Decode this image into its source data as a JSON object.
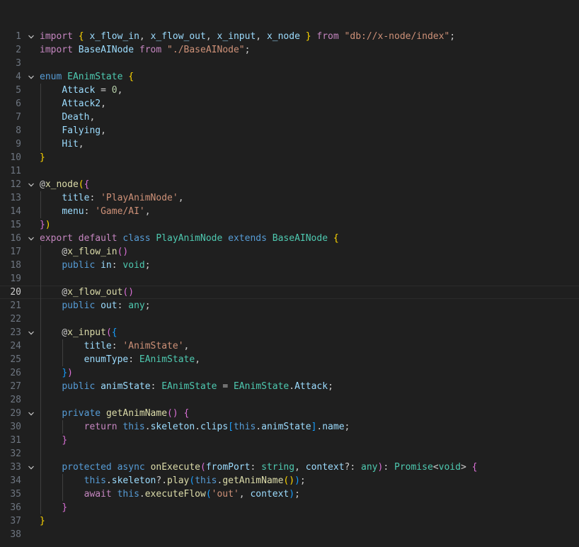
{
  "editor": {
    "foldable_lines": [
      1,
      4,
      12,
      16,
      23,
      29,
      33
    ],
    "active_line": 20,
    "colors": {
      "background": "#1f1f1f",
      "line_number": "#6e7681",
      "keyword": "#569cd6",
      "control": "#c586c0",
      "string": "#ce9178",
      "variable": "#9cdcfe",
      "type": "#4ec9b0",
      "function": "#dcdcaa",
      "number": "#b5cea8",
      "bracket_1": "#ffd700",
      "bracket_2": "#da70d6",
      "bracket_3": "#179fff"
    },
    "lines": [
      [
        [
          "ctl",
          "import"
        ],
        [
          "pun",
          " "
        ],
        [
          "b1",
          "{"
        ],
        [
          "pun",
          " "
        ],
        [
          "var",
          "x_flow_in"
        ],
        [
          "pun",
          ", "
        ],
        [
          "var",
          "x_flow_out"
        ],
        [
          "pun",
          ", "
        ],
        [
          "var",
          "x_input"
        ],
        [
          "pun",
          ", "
        ],
        [
          "var",
          "x_node"
        ],
        [
          "pun",
          " "
        ],
        [
          "b1",
          "}"
        ],
        [
          "pun",
          " "
        ],
        [
          "ctl",
          "from"
        ],
        [
          "pun",
          " "
        ],
        [
          "str",
          "\"db://x-node/index\""
        ],
        [
          "pun",
          ";"
        ]
      ],
      [
        [
          "ctl",
          "import"
        ],
        [
          "pun",
          " "
        ],
        [
          "var",
          "BaseAINode"
        ],
        [
          "pun",
          " "
        ],
        [
          "ctl",
          "from"
        ],
        [
          "pun",
          " "
        ],
        [
          "str",
          "\"./BaseAINode\""
        ],
        [
          "pun",
          ";"
        ]
      ],
      [],
      [
        [
          "kw",
          "enum"
        ],
        [
          "pun",
          " "
        ],
        [
          "typ",
          "EAnimState"
        ],
        [
          "pun",
          " "
        ],
        [
          "b1",
          "{"
        ]
      ],
      [
        [
          "pun",
          "    "
        ],
        [
          "var",
          "Attack"
        ],
        [
          "pun",
          " = "
        ],
        [
          "num",
          "0"
        ],
        [
          "pun",
          ","
        ]
      ],
      [
        [
          "pun",
          "    "
        ],
        [
          "var",
          "Attack2"
        ],
        [
          "pun",
          ","
        ]
      ],
      [
        [
          "pun",
          "    "
        ],
        [
          "var",
          "Death"
        ],
        [
          "pun",
          ","
        ]
      ],
      [
        [
          "pun",
          "    "
        ],
        [
          "var",
          "Falying"
        ],
        [
          "pun",
          ","
        ]
      ],
      [
        [
          "pun",
          "    "
        ],
        [
          "var",
          "Hit"
        ],
        [
          "pun",
          ","
        ]
      ],
      [
        [
          "b1",
          "}"
        ]
      ],
      [],
      [
        [
          "pun",
          "@"
        ],
        [
          "fn",
          "x_node"
        ],
        [
          "b1",
          "("
        ],
        [
          "b2",
          "{"
        ]
      ],
      [
        [
          "pun",
          "    "
        ],
        [
          "var",
          "title"
        ],
        [
          "pun",
          ": "
        ],
        [
          "str",
          "'PlayAnimNode'"
        ],
        [
          "pun",
          ","
        ]
      ],
      [
        [
          "pun",
          "    "
        ],
        [
          "var",
          "menu"
        ],
        [
          "pun",
          ": "
        ],
        [
          "str",
          "'Game/AI'"
        ],
        [
          "pun",
          ","
        ]
      ],
      [
        [
          "b2",
          "}"
        ],
        [
          "b1",
          ")"
        ]
      ],
      [
        [
          "ctl",
          "export"
        ],
        [
          "pun",
          " "
        ],
        [
          "ctl",
          "default"
        ],
        [
          "pun",
          " "
        ],
        [
          "kw",
          "class"
        ],
        [
          "pun",
          " "
        ],
        [
          "typ",
          "PlayAnimNode"
        ],
        [
          "pun",
          " "
        ],
        [
          "kw",
          "extends"
        ],
        [
          "pun",
          " "
        ],
        [
          "typ",
          "BaseAINode"
        ],
        [
          "pun",
          " "
        ],
        [
          "b1",
          "{"
        ]
      ],
      [
        [
          "pun",
          "    @"
        ],
        [
          "fn",
          "x_flow_in"
        ],
        [
          "b2",
          "()"
        ]
      ],
      [
        [
          "pun",
          "    "
        ],
        [
          "kw",
          "public"
        ],
        [
          "pun",
          " "
        ],
        [
          "var",
          "in"
        ],
        [
          "pun",
          ": "
        ],
        [
          "typ",
          "void"
        ],
        [
          "pun",
          ";"
        ]
      ],
      [],
      [
        [
          "pun",
          "    @"
        ],
        [
          "fn",
          "x_flow_out"
        ],
        [
          "b2",
          "()"
        ]
      ],
      [
        [
          "pun",
          "    "
        ],
        [
          "kw",
          "public"
        ],
        [
          "pun",
          " "
        ],
        [
          "var",
          "out"
        ],
        [
          "pun",
          ": "
        ],
        [
          "typ",
          "any"
        ],
        [
          "pun",
          ";"
        ]
      ],
      [],
      [
        [
          "pun",
          "    @"
        ],
        [
          "fn",
          "x_input"
        ],
        [
          "b2",
          "("
        ],
        [
          "b3",
          "{"
        ]
      ],
      [
        [
          "pun",
          "        "
        ],
        [
          "var",
          "title"
        ],
        [
          "pun",
          ": "
        ],
        [
          "str",
          "'AnimState'"
        ],
        [
          "pun",
          ","
        ]
      ],
      [
        [
          "pun",
          "        "
        ],
        [
          "var",
          "enumType"
        ],
        [
          "pun",
          ": "
        ],
        [
          "typ",
          "EAnimState"
        ],
        [
          "pun",
          ","
        ]
      ],
      [
        [
          "pun",
          "    "
        ],
        [
          "b3",
          "}"
        ],
        [
          "b2",
          ")"
        ]
      ],
      [
        [
          "pun",
          "    "
        ],
        [
          "kw",
          "public"
        ],
        [
          "pun",
          " "
        ],
        [
          "var",
          "animState"
        ],
        [
          "pun",
          ": "
        ],
        [
          "typ",
          "EAnimState"
        ],
        [
          "pun",
          " = "
        ],
        [
          "typ",
          "EAnimState"
        ],
        [
          "pun",
          "."
        ],
        [
          "var",
          "Attack"
        ],
        [
          "pun",
          ";"
        ]
      ],
      [],
      [
        [
          "pun",
          "    "
        ],
        [
          "kw",
          "private"
        ],
        [
          "pun",
          " "
        ],
        [
          "fn",
          "getAnimName"
        ],
        [
          "b2",
          "()"
        ],
        [
          "pun",
          " "
        ],
        [
          "b2",
          "{"
        ]
      ],
      [
        [
          "pun",
          "        "
        ],
        [
          "ctl",
          "return"
        ],
        [
          "pun",
          " "
        ],
        [
          "kw",
          "this"
        ],
        [
          "pun",
          "."
        ],
        [
          "var",
          "skeleton"
        ],
        [
          "pun",
          "."
        ],
        [
          "var",
          "clips"
        ],
        [
          "b3",
          "["
        ],
        [
          "kw",
          "this"
        ],
        [
          "pun",
          "."
        ],
        [
          "var",
          "animState"
        ],
        [
          "b3",
          "]"
        ],
        [
          "pun",
          "."
        ],
        [
          "var",
          "name"
        ],
        [
          "pun",
          ";"
        ]
      ],
      [
        [
          "pun",
          "    "
        ],
        [
          "b2",
          "}"
        ]
      ],
      [],
      [
        [
          "pun",
          "    "
        ],
        [
          "kw",
          "protected"
        ],
        [
          "pun",
          " "
        ],
        [
          "kw",
          "async"
        ],
        [
          "pun",
          " "
        ],
        [
          "fn",
          "onExecute"
        ],
        [
          "b2",
          "("
        ],
        [
          "var",
          "fromPort"
        ],
        [
          "pun",
          ": "
        ],
        [
          "typ",
          "string"
        ],
        [
          "pun",
          ", "
        ],
        [
          "var",
          "context"
        ],
        [
          "pun",
          "?: "
        ],
        [
          "typ",
          "any"
        ],
        [
          "b2",
          ")"
        ],
        [
          "pun",
          ": "
        ],
        [
          "typ",
          "Promise"
        ],
        [
          "pun",
          "<"
        ],
        [
          "typ",
          "void"
        ],
        [
          "pun",
          "> "
        ],
        [
          "b2",
          "{"
        ]
      ],
      [
        [
          "pun",
          "        "
        ],
        [
          "kw",
          "this"
        ],
        [
          "pun",
          "."
        ],
        [
          "var",
          "skeleton"
        ],
        [
          "pun",
          "?."
        ],
        [
          "fn",
          "play"
        ],
        [
          "b3",
          "("
        ],
        [
          "kw",
          "this"
        ],
        [
          "pun",
          "."
        ],
        [
          "fn",
          "getAnimName"
        ],
        [
          "b1",
          "()"
        ],
        [
          "b3",
          ")"
        ],
        [
          "pun",
          ";"
        ]
      ],
      [
        [
          "pun",
          "        "
        ],
        [
          "ctl",
          "await"
        ],
        [
          "pun",
          " "
        ],
        [
          "kw",
          "this"
        ],
        [
          "pun",
          "."
        ],
        [
          "fn",
          "executeFlow"
        ],
        [
          "b3",
          "("
        ],
        [
          "str",
          "'out'"
        ],
        [
          "pun",
          ", "
        ],
        [
          "var",
          "context"
        ],
        [
          "b3",
          ")"
        ],
        [
          "pun",
          ";"
        ]
      ],
      [
        [
          "pun",
          "    "
        ],
        [
          "b2",
          "}"
        ]
      ],
      [
        [
          "b1",
          "}"
        ]
      ],
      []
    ]
  }
}
